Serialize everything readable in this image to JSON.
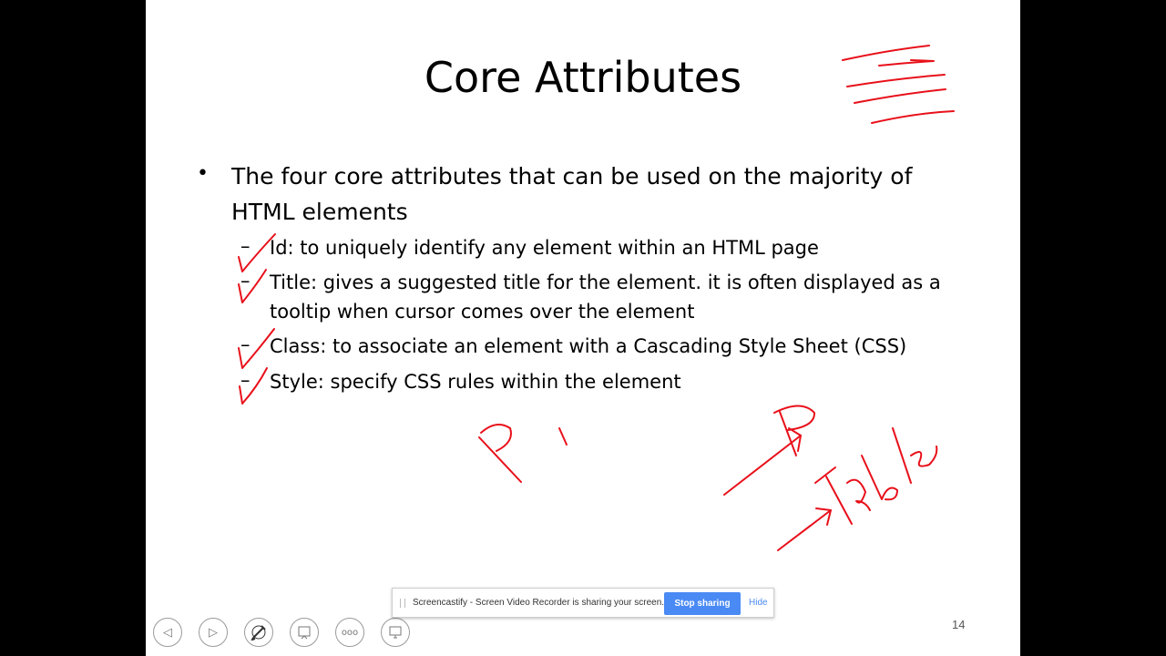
{
  "slide": {
    "title": "Core Attributes",
    "bullet": "The four core attributes that can be used on the majority of HTML elements",
    "bullet_line1": "The four core attributes that can be used on the majority of",
    "bullet_line2": "HTML elements",
    "dash": "–",
    "sub_items": [
      {
        "line1": "Id: to uniquely identify any element within an HTML page"
      },
      {
        "line1": "Title: gives a suggested title for the element. it is often displayed as a",
        "line2": "tooltip when cursor comes over the element"
      },
      {
        "line1": "Class:  to associate an element with a Cascading Style Sheet (CSS)"
      },
      {
        "line1": "Style:  specify CSS rules within the element"
      }
    ],
    "page_number": "14"
  },
  "annotations": {
    "ink_color": "#e8101a",
    "handwriting": [
      "P",
      "Table"
    ]
  },
  "share_bar": {
    "message": "Screencastify - Screen Video Recorder is sharing your screen.",
    "stop_label": "Stop sharing",
    "hide_label": "Hide",
    "button_color": "#4a8af4"
  },
  "toolbar": {
    "icons": [
      "previous-slide-icon",
      "next-slide-icon",
      "pen-tool-icon",
      "slide-overview-icon",
      "more-options-icon",
      "zoom-icon"
    ],
    "more_label": "ooo"
  }
}
